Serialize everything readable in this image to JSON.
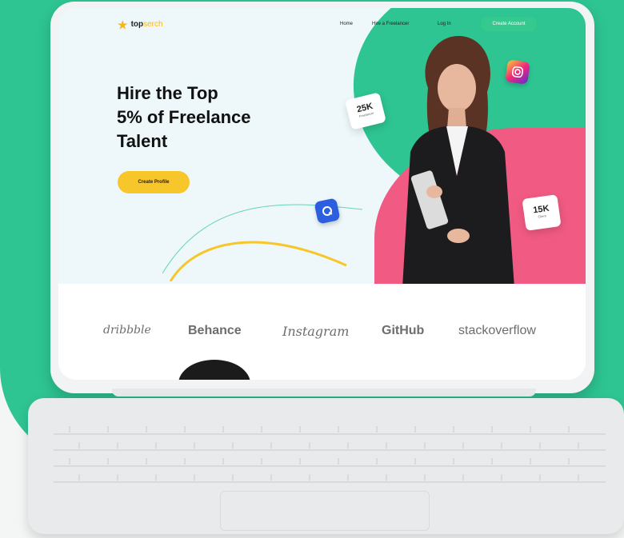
{
  "nav": {
    "logo_main": "top",
    "logo_sub": "serch",
    "home": "Home",
    "hire": "Hire a Freelancer",
    "login": "Log In",
    "create_account": "Create Account"
  },
  "hero": {
    "headline_line1": "Hire the Top",
    "headline_line2": "5% of Freelance",
    "headline_line3": "Talent",
    "cta": "Create Profile"
  },
  "cards": {
    "freelancers_value": "25K",
    "freelancers_label": "Freelancer",
    "clients_value": "15K",
    "clients_label": "Client"
  },
  "brands": [
    "dribbble",
    "Behance",
    "Instagram",
    "GitHub",
    "stackoverflow"
  ],
  "colors": {
    "green": "#2ec592",
    "pink": "#f05a83",
    "yellow": "#f7c62a",
    "blue": "#2b5fe0"
  },
  "icons": [
    "star-logo-icon",
    "instagram-icon",
    "app-icon"
  ]
}
